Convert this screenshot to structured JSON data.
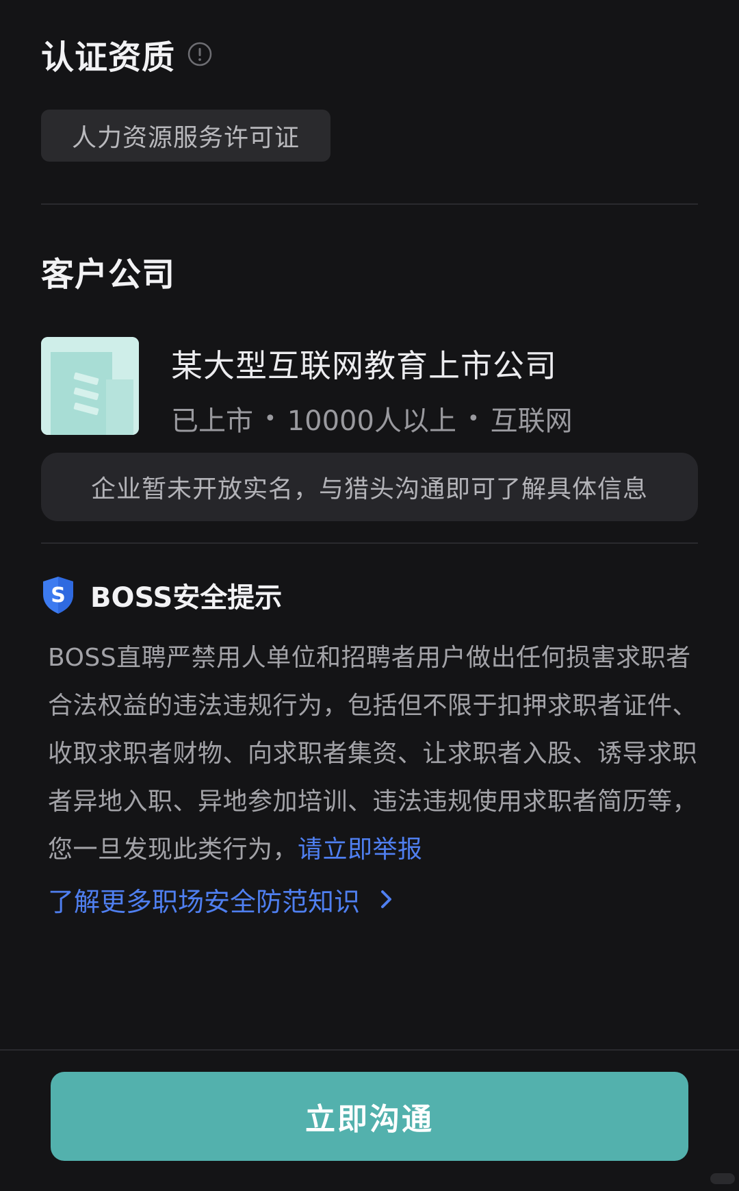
{
  "certification": {
    "title": "认证资质",
    "badge": "人力资源服务许可证"
  },
  "client_company": {
    "title": "客户公司",
    "name": "某大型互联网教育上市公司",
    "meta": {
      "status": "已上市",
      "size": "10000人以上",
      "industry": "互联网"
    },
    "notice": "企业暂未开放实名，与猎头沟通即可了解具体信息"
  },
  "safety": {
    "title": "BOSS安全提示",
    "body": "BOSS直聘严禁用人单位和招聘者用户做出任何损害求职者合法权益的违法违规行为，包括但不限于扣押求职者证件、收取求职者财物、向求职者集资、让求职者入股、诱导求职者异地入职、异地参加培训、违法违规使用求职者简历等，您一旦发现此类行为，",
    "report_link": "请立即举报",
    "learn_more": "了解更多职场安全防范知识"
  },
  "actions": {
    "chat_now": "立即沟通"
  },
  "colors": {
    "background": "#141416",
    "accent_teal": "#53b1ad",
    "link_blue": "#4f7ff0"
  },
  "icons": {
    "info": "info-circle-icon",
    "logo": "building-icon",
    "shield": "shield-s-icon",
    "chevron": "chevron-right-icon"
  }
}
